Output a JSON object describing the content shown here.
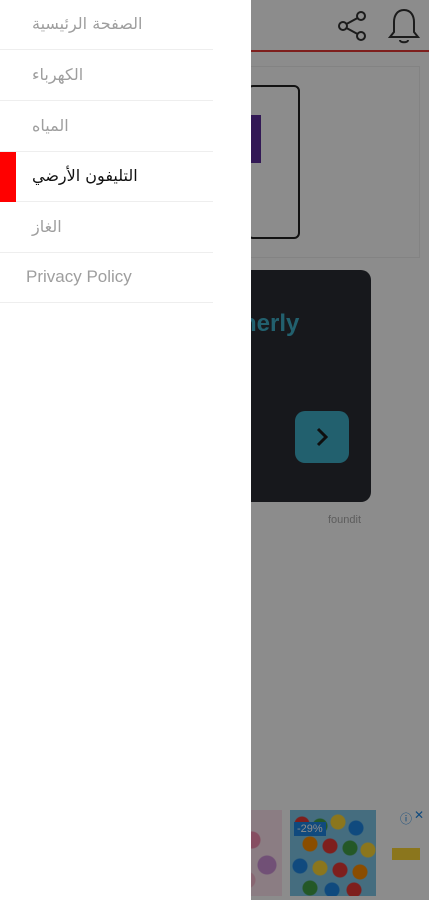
{
  "colors": {
    "accent": "#ff0000",
    "topbar_border": "#e53935",
    "inactive_text": "#9e9e9e",
    "active_text": "#111111"
  },
  "app": {
    "topbar": {
      "bell_icon": "bell-icon",
      "share_icon": "share-icon"
    },
    "ad": {
      "title_fragment": "nerly",
      "source": "foundit"
    },
    "bottom_banner": {
      "discount": "-29%"
    }
  },
  "drawer": {
    "items": [
      {
        "label": "الصفحة الرئيسية",
        "active": false
      },
      {
        "label": "الكهرباء",
        "active": false
      },
      {
        "label": "المياه",
        "active": false
      },
      {
        "label": "التليفون الأرضي",
        "active": true
      },
      {
        "label": "الغاز",
        "active": false
      },
      {
        "label": "Privacy Policy",
        "active": false
      }
    ]
  }
}
